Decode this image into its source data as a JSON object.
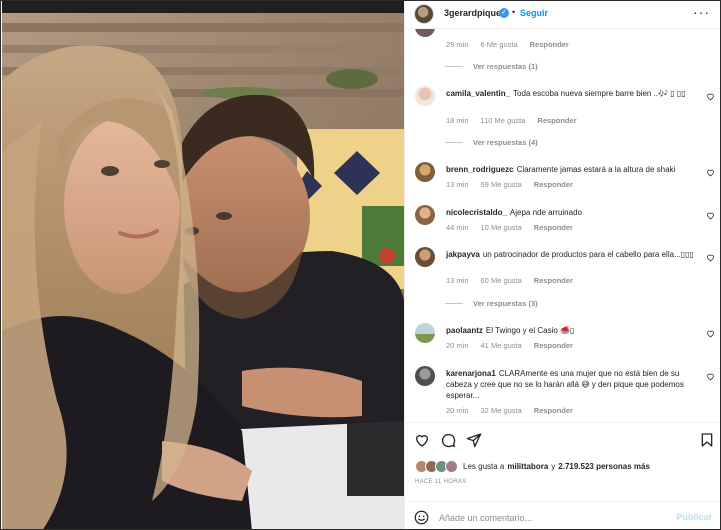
{
  "post": {
    "username": "3gerardpique",
    "follow_label": "Seguir",
    "more_label": "···",
    "separator": "•"
  },
  "comments": {
    "top": {
      "time": "29 min",
      "likes": "6 Me gusta",
      "reply": "Responder"
    },
    "view_replies_1": "Ver respuestas (1)",
    "items": [
      {
        "user": "camila_valentin_",
        "text": "Toda escoba nueva siempre barre bien ..🎶 ▯ ▯▯",
        "time": "18 min",
        "likes": "110 Me gusta",
        "reply": "Responder"
      },
      {
        "user": "brenn_rodriguezc",
        "text": "Claramente jamas estará a la altura de shaki",
        "time": "13 min",
        "likes": "69 Me gusta",
        "reply": "Responder"
      },
      {
        "user": "nicolecristaldo_",
        "text": "Ajepa nde arruinado",
        "time": "44 min",
        "likes": "10 Me gusta",
        "reply": "Responder"
      },
      {
        "user": "jakpayva",
        "text": "un patrocinador de productos para el cabello para ella...▯▯▯",
        "time": "13 min",
        "likes": "60 Me gusta",
        "reply": "Responder"
      },
      {
        "user": "paolaantz",
        "text": "El Twingo y el Casio 🥌▯",
        "time": "20 min",
        "likes": "41 Me gusta",
        "reply": "Responder"
      },
      {
        "user": "karenarjona1",
        "text": "CLARAmente es una mujer que no está bien de su cabeza y cree que no se lo harán allá 😅 y den pique que podemos esperar...",
        "time": "20 min",
        "likes": "32 Me gusta",
        "reply": "Responder"
      }
    ],
    "view_replies_4": "Ver respuestas (4)",
    "view_replies_3": "Ver respuestas (3)"
  },
  "actions": {
    "likes_prefix": "Les gusta a",
    "likes_user": "milittabora",
    "likes_and": "y",
    "likes_count": "2.719.523 personas más",
    "time_ago": "HACE 11 HORAS",
    "comment_placeholder": "Añade un comentario...",
    "publish_label": "Publicar"
  },
  "colors": {
    "accent": "#0095f6",
    "muted": "#8e8e8e",
    "publish_disabled": "#b2dffc"
  }
}
